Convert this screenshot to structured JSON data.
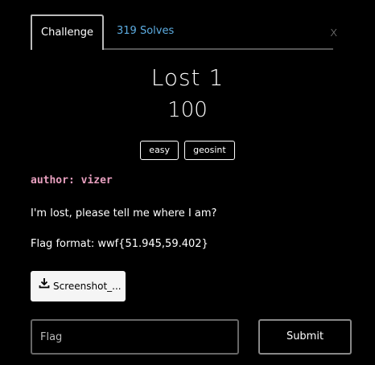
{
  "tabs": {
    "challenge_label": "Challenge",
    "solves_label": "319 Solves"
  },
  "close_label": "x",
  "challenge": {
    "name": "Lost 1",
    "points": "100",
    "tags": [
      "easy",
      "geosint"
    ],
    "author": "author: vizer",
    "description": "I'm lost, please tell me where I am?",
    "flag_format": "Flag format: wwf{51.945,59.402}"
  },
  "file": {
    "label": "Screenshot_...",
    "icon": "download-icon"
  },
  "form": {
    "flag_placeholder": "Flag",
    "submit_label": "Submit"
  },
  "colors": {
    "solves_link": "#5dade2",
    "author": "#e8a0bf",
    "background": "#000000"
  }
}
